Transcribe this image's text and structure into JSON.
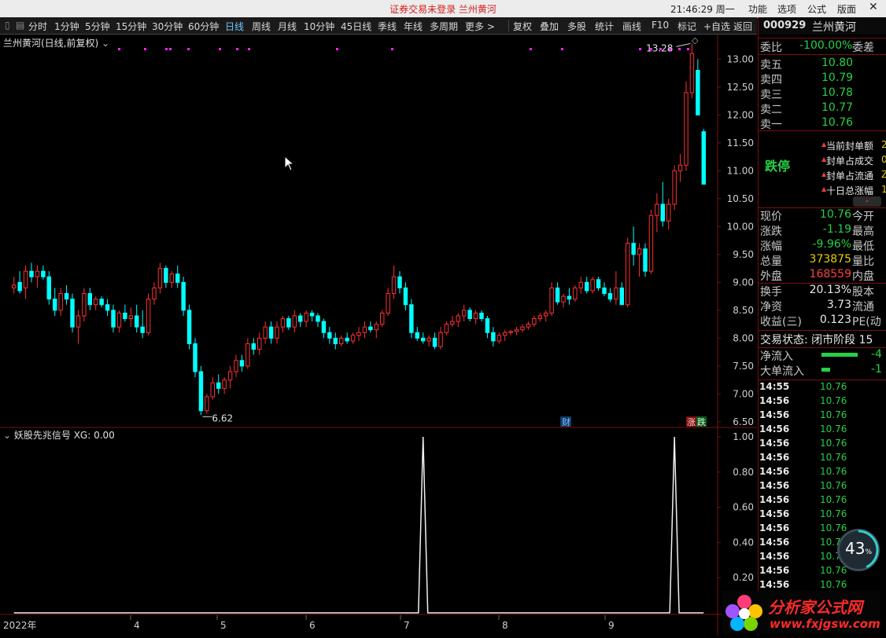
{
  "titlebar": {
    "notice": "证券交易未登录  兰州黄河",
    "clock": "21:46:29 周一",
    "menu": [
      "功能",
      "选项",
      "公式",
      "版面"
    ],
    "close": "✕"
  },
  "toolbar": {
    "periods": [
      "分时",
      "1分钟",
      "5分钟",
      "15分钟",
      "30分钟",
      "60分钟",
      "日线",
      "周线",
      "月线",
      "10分钟",
      "45日线",
      "季线",
      "年线",
      "多周期",
      "更多 >"
    ],
    "active_period": "日线",
    "tools": [
      "复权",
      "叠加",
      "多股",
      "统计",
      "画线",
      "F10",
      "标记",
      "+自选",
      "返回"
    ]
  },
  "main_chart": {
    "title": "兰州黄河(日线,前复权)",
    "y_ticks": [
      "13.00",
      "12.50",
      "12.00",
      "11.50",
      "11.00",
      "10.50",
      "10.00",
      "9.50",
      "9.00",
      "8.50",
      "8.00",
      "7.50",
      "7.00",
      "6.50"
    ],
    "high_label": "13.28",
    "low_label": "6.62",
    "badge_cai": "财",
    "badge_zhang": "涨",
    "badge_die": "跌"
  },
  "indicator": {
    "title": "妖股先兆信号 XG: 0.00",
    "y_ticks": [
      "1.00",
      "0.80",
      "0.60",
      "0.40",
      "0.20"
    ]
  },
  "x_axis": {
    "labels": [
      "2022年",
      "4",
      "5",
      "6",
      "7",
      "8",
      "9"
    ]
  },
  "chart_data": {
    "type": "candlestick",
    "ylim": [
      6.4,
      13.3
    ],
    "candles": [
      [
        8.9,
        9.1,
        8.8,
        8.95
      ],
      [
        9.0,
        9.2,
        8.8,
        8.85
      ],
      [
        8.9,
        9.3,
        8.7,
        9.2
      ],
      [
        9.2,
        9.35,
        9.0,
        9.1
      ],
      [
        9.1,
        9.3,
        8.9,
        9.2
      ],
      [
        9.2,
        9.3,
        9.05,
        9.1
      ],
      [
        9.1,
        9.2,
        8.6,
        8.7
      ],
      [
        8.7,
        8.9,
        8.4,
        8.5
      ],
      [
        8.5,
        8.9,
        8.4,
        8.8
      ],
      [
        8.8,
        8.95,
        8.6,
        8.7
      ],
      [
        8.7,
        8.8,
        8.1,
        8.2
      ],
      [
        8.2,
        8.5,
        7.9,
        8.4
      ],
      [
        8.4,
        8.9,
        8.3,
        8.8
      ],
      [
        8.8,
        8.9,
        8.5,
        8.6
      ],
      [
        8.6,
        8.75,
        8.5,
        8.7
      ],
      [
        8.7,
        8.75,
        8.55,
        8.6
      ],
      [
        8.6,
        8.7,
        8.4,
        8.5
      ],
      [
        8.5,
        8.6,
        8.1,
        8.2
      ],
      [
        8.2,
        8.5,
        8.1,
        8.45
      ],
      [
        8.45,
        8.6,
        8.3,
        8.35
      ],
      [
        8.35,
        8.55,
        8.2,
        8.4
      ],
      [
        8.4,
        8.6,
        8.1,
        8.2
      ],
      [
        8.2,
        8.5,
        8.0,
        8.1
      ],
      [
        8.1,
        8.8,
        8.05,
        8.7
      ],
      [
        8.7,
        9.0,
        8.6,
        8.9
      ],
      [
        8.9,
        9.35,
        8.8,
        9.25
      ],
      [
        9.25,
        9.3,
        8.9,
        9.0
      ],
      [
        9.0,
        9.2,
        8.9,
        9.15
      ],
      [
        9.15,
        9.3,
        8.9,
        9.0
      ],
      [
        9.0,
        9.1,
        8.4,
        8.5
      ],
      [
        8.5,
        8.6,
        7.8,
        7.9
      ],
      [
        7.9,
        8.0,
        7.3,
        7.4
      ],
      [
        7.4,
        7.5,
        6.62,
        6.7
      ],
      [
        6.7,
        7.0,
        6.65,
        6.95
      ],
      [
        6.95,
        7.3,
        6.9,
        7.2
      ],
      [
        7.2,
        7.35,
        7.0,
        7.1
      ],
      [
        7.1,
        7.3,
        7.0,
        7.25
      ],
      [
        7.25,
        7.5,
        7.1,
        7.4
      ],
      [
        7.4,
        7.7,
        7.3,
        7.6
      ],
      [
        7.6,
        7.7,
        7.4,
        7.5
      ],
      [
        7.5,
        8.0,
        7.45,
        7.9
      ],
      [
        7.9,
        8.0,
        7.7,
        7.8
      ],
      [
        7.8,
        8.1,
        7.7,
        8.0
      ],
      [
        8.0,
        8.3,
        7.9,
        8.2
      ],
      [
        8.2,
        8.3,
        7.9,
        8.0
      ],
      [
        8.0,
        8.3,
        7.9,
        8.2
      ],
      [
        8.2,
        8.4,
        8.1,
        8.35
      ],
      [
        8.35,
        8.4,
        8.15,
        8.2
      ],
      [
        8.2,
        8.5,
        8.1,
        8.4
      ],
      [
        8.4,
        8.45,
        8.2,
        8.3
      ],
      [
        8.3,
        8.5,
        8.2,
        8.45
      ],
      [
        8.45,
        8.5,
        8.3,
        8.4
      ],
      [
        8.4,
        8.45,
        8.2,
        8.3
      ],
      [
        8.3,
        8.35,
        8.0,
        8.1
      ],
      [
        8.1,
        8.2,
        7.9,
        8.0
      ],
      [
        8.0,
        8.1,
        7.8,
        7.9
      ],
      [
        7.9,
        8.05,
        7.85,
        8.0
      ],
      [
        8.0,
        8.1,
        7.9,
        7.95
      ],
      [
        7.95,
        8.1,
        7.9,
        8.05
      ],
      [
        8.05,
        8.2,
        7.95,
        8.1
      ],
      [
        8.1,
        8.3,
        8.0,
        8.2
      ],
      [
        8.2,
        8.3,
        8.1,
        8.15
      ],
      [
        8.15,
        8.3,
        8.0,
        8.25
      ],
      [
        8.25,
        8.5,
        8.2,
        8.45
      ],
      [
        8.45,
        8.9,
        8.4,
        8.8
      ],
      [
        8.8,
        9.3,
        8.7,
        9.1
      ],
      [
        9.1,
        9.2,
        8.8,
        8.9
      ],
      [
        8.9,
        9.0,
        8.5,
        8.6
      ],
      [
        8.6,
        8.7,
        8.0,
        8.1
      ],
      [
        8.1,
        8.2,
        7.95,
        8.0
      ],
      [
        8.0,
        8.1,
        7.9,
        7.95
      ],
      [
        7.95,
        8.05,
        7.85,
        8.0
      ],
      [
        8.0,
        8.1,
        7.8,
        7.85
      ],
      [
        7.85,
        8.2,
        7.8,
        8.1
      ],
      [
        8.1,
        8.3,
        8.05,
        8.25
      ],
      [
        8.25,
        8.4,
        8.2,
        8.3
      ],
      [
        8.3,
        8.45,
        8.2,
        8.4
      ],
      [
        8.4,
        8.6,
        8.3,
        8.5
      ],
      [
        8.5,
        8.55,
        8.3,
        8.35
      ],
      [
        8.35,
        8.5,
        8.25,
        8.45
      ],
      [
        8.45,
        8.5,
        8.3,
        8.35
      ],
      [
        8.35,
        8.4,
        8.0,
        8.1
      ],
      [
        8.1,
        8.2,
        7.85,
        7.95
      ],
      [
        7.95,
        8.1,
        7.9,
        8.05
      ],
      [
        8.05,
        8.15,
        7.95,
        8.1
      ],
      [
        8.1,
        8.15,
        8.05,
        8.12
      ],
      [
        8.12,
        8.2,
        8.05,
        8.15
      ],
      [
        8.15,
        8.25,
        8.1,
        8.2
      ],
      [
        8.2,
        8.3,
        8.15,
        8.25
      ],
      [
        8.25,
        8.4,
        8.2,
        8.35
      ],
      [
        8.35,
        8.45,
        8.3,
        8.4
      ],
      [
        8.4,
        8.5,
        8.3,
        8.45
      ],
      [
        8.45,
        9.0,
        8.4,
        8.9
      ],
      [
        8.9,
        9.0,
        8.6,
        8.65
      ],
      [
        8.65,
        8.8,
        8.55,
        8.75
      ],
      [
        8.75,
        8.9,
        8.6,
        8.7
      ],
      [
        8.7,
        8.95,
        8.65,
        8.9
      ],
      [
        8.9,
        9.1,
        8.8,
        9.0
      ],
      [
        9.0,
        9.1,
        8.8,
        8.85
      ],
      [
        8.85,
        9.1,
        8.8,
        9.05
      ],
      [
        9.05,
        9.1,
        8.85,
        8.9
      ],
      [
        8.9,
        9.0,
        8.75,
        8.8
      ],
      [
        8.8,
        8.9,
        8.65,
        8.7
      ],
      [
        8.7,
        9.2,
        8.6,
        8.9
      ],
      [
        8.9,
        9.0,
        8.6,
        8.6
      ],
      [
        8.6,
        9.8,
        8.55,
        9.7
      ],
      [
        9.7,
        10.0,
        9.3,
        9.5
      ],
      [
        9.5,
        9.7,
        9.1,
        9.6
      ],
      [
        9.6,
        9.7,
        9.1,
        9.2
      ],
      [
        9.2,
        10.3,
        9.15,
        10.2
      ],
      [
        10.2,
        10.6,
        9.9,
        10.4
      ],
      [
        10.4,
        10.8,
        10.0,
        10.1
      ],
      [
        10.1,
        10.5,
        9.95,
        10.4
      ],
      [
        10.4,
        11.1,
        10.3,
        11.0
      ],
      [
        11.0,
        11.3,
        10.8,
        11.1
      ],
      [
        11.1,
        12.6,
        11.0,
        12.4
      ],
      [
        12.4,
        13.28,
        12.3,
        13.1
      ],
      [
        12.8,
        13.0,
        12.0,
        12.0
      ],
      [
        11.7,
        11.75,
        10.76,
        10.76
      ]
    ],
    "signal": {
      "ylim": [
        0,
        1.0
      ],
      "spikes": [
        70,
        113
      ]
    }
  },
  "right_panel": {
    "code": "000929",
    "name": "兰州黄河",
    "weibi_label": "委比",
    "weibi_value": "-100.00%",
    "weicha_label": "委差",
    "asks": [
      {
        "label": "卖五",
        "price": "10.80"
      },
      {
        "label": "卖四",
        "price": "10.79"
      },
      {
        "label": "卖三",
        "price": "10.78"
      },
      {
        "label": "卖二",
        "price": "10.77"
      },
      {
        "label": "卖一",
        "price": "10.76"
      }
    ],
    "limit_status": "跌停",
    "seal_items": [
      {
        "label": "当前封单额",
        "mark": "2"
      },
      {
        "label": "封单占成交",
        "mark": "0"
      },
      {
        "label": "封单占流通",
        "mark": "Z"
      },
      {
        "label": "十日总涨幅",
        "mark": "1"
      }
    ],
    "quote": [
      {
        "l1": "现价",
        "v1": "10.76",
        "c1": "green",
        "l2": "今开"
      },
      {
        "l1": "涨跌",
        "v1": "-1.19",
        "c1": "green",
        "l2": "最高"
      },
      {
        "l1": "涨幅",
        "v1": "-9.96%",
        "c1": "green",
        "l2": "最低"
      },
      {
        "l1": "总量",
        "v1": "373875",
        "c1": "yellow",
        "l2": "量比"
      },
      {
        "l1": "外盘",
        "v1": "168559",
        "c1": "red",
        "l2": "内盘"
      }
    ],
    "quote2": [
      {
        "l1": "换手",
        "v1": "20.13%",
        "c1": "white",
        "l2": "股本"
      },
      {
        "l1": "净资",
        "v1": "3.73",
        "c1": "white",
        "l2": "流通"
      },
      {
        "l1": "收益(三)",
        "v1": "0.123",
        "c1": "white",
        "l2": "PE(动"
      }
    ],
    "trade_status": "交易状态: 闭市阶段 15",
    "net_inflow_label": "净流入",
    "net_inflow_value": "-4",
    "big_inflow_label": "大单流入",
    "big_inflow_value": "-1",
    "ticks": [
      {
        "time": "14:55",
        "price": "10.76"
      },
      {
        "time": "14:56",
        "price": "10.76"
      },
      {
        "time": "14:56",
        "price": "10.76"
      },
      {
        "time": "14:56",
        "price": "10.76"
      },
      {
        "time": "14:56",
        "price": "10.76"
      },
      {
        "time": "14:56",
        "price": "10.76"
      },
      {
        "time": "14:56",
        "price": "10.76"
      },
      {
        "time": "14:56",
        "price": "10.76"
      },
      {
        "time": "14:56",
        "price": "10.76"
      },
      {
        "time": "14:56",
        "price": "10.76"
      },
      {
        "time": "14:56",
        "price": "10.76"
      },
      {
        "time": "14:56",
        "price": "10.76"
      },
      {
        "time": "14:56",
        "price": "10.76"
      },
      {
        "time": "14:56",
        "price": "10.76"
      },
      {
        "time": "14:56",
        "price": "10.76"
      }
    ],
    "gauge": "43",
    "gauge_unit": "%"
  },
  "watermark": {
    "brand": "分析家公式网",
    "url": "www.fxjgsw.com"
  },
  "colors": {
    "up": "#ff3030",
    "down": "#00ffff",
    "grid": "#7a1010"
  }
}
